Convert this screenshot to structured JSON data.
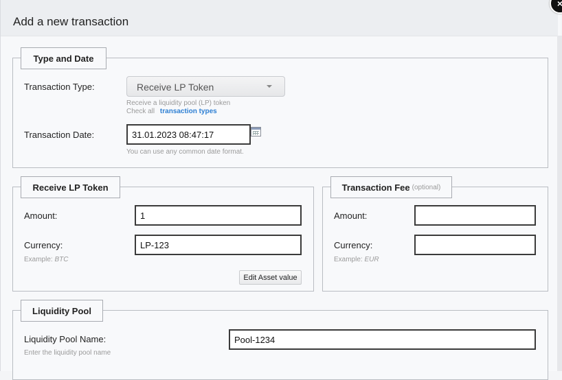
{
  "dialog": {
    "title": "Add a new transaction",
    "close_symbol": "×"
  },
  "type_and_date": {
    "legend": "Type and Date",
    "type_label": "Transaction Type:",
    "type_value": "Receive LP Token",
    "type_hint": "Receive a liquidity pool (LP) token",
    "check_all_text": "Check all",
    "check_all_link": "transaction types",
    "date_label": "Transaction Date:",
    "date_value": "31.01.2023 08:47:17",
    "date_hint": "You can use any common date format."
  },
  "receive": {
    "legend": "Receive LP Token",
    "amount_label": "Amount:",
    "amount_value": "1",
    "currency_label": "Currency:",
    "currency_value": "LP-123",
    "example_prefix": "Example: ",
    "example_value": "BTC",
    "edit_button": "Edit Asset value"
  },
  "fee": {
    "legend": "Transaction Fee",
    "legend_optional": "(optional)",
    "amount_label": "Amount:",
    "amount_value": "",
    "currency_label": "Currency:",
    "currency_value": "",
    "example_prefix": "Example: ",
    "example_value": "EUR"
  },
  "pool": {
    "legend": "Liquidity Pool",
    "name_label": "Liquidity Pool Name:",
    "name_value": "Pool-1234",
    "name_hint": "Enter the liquidity pool name"
  },
  "icons": {
    "calendar": "calendar-icon",
    "dropdown": "chevron-down-icon",
    "close": "close-icon"
  }
}
